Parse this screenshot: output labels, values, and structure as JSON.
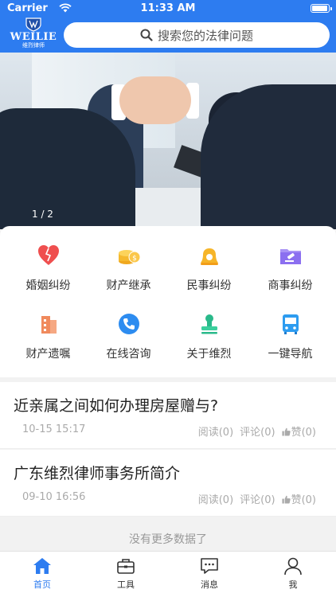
{
  "status_bar": {
    "carrier": "Carrier",
    "time": "11:33 AM"
  },
  "logo": {
    "word": "WEILIE",
    "subtitle": "维烈律师"
  },
  "search": {
    "placeholder": "搜索您的法律问题"
  },
  "banner": {
    "counter": "1 / 2"
  },
  "categories": [
    {
      "label": "婚姻纠纷",
      "icon": "broken-heart-icon",
      "color": "#ef4f4f"
    },
    {
      "label": "财产继承",
      "icon": "coins-icon",
      "color": "#f5b92e"
    },
    {
      "label": "民事纠纷",
      "icon": "bell-icon",
      "color": "#f6b529"
    },
    {
      "label": "商事纠纷",
      "icon": "gavel-folder-icon",
      "color": "#8b6ff0"
    },
    {
      "label": "财产遗嘱",
      "icon": "building-icon",
      "color": "#f08a5d"
    },
    {
      "label": "在线咨询",
      "icon": "phone-icon",
      "color": "#2d8cf0"
    },
    {
      "label": "关于维烈",
      "icon": "stamp-icon",
      "color": "#29b98a"
    },
    {
      "label": "一键导航",
      "icon": "bus-icon",
      "color": "#2d9cf0"
    }
  ],
  "articles": [
    {
      "title": "近亲属之间如何办理房屋赠与?",
      "date": "10-15 15:17",
      "reads": "阅读(0)",
      "comments": "评论(0)",
      "likes": "赞(0)"
    },
    {
      "title": "广东维烈律师事务所简介",
      "date": "09-10 16:56",
      "reads": "阅读(0)",
      "comments": "评论(0)",
      "likes": "赞(0)"
    }
  ],
  "list_footer": "没有更多数据了",
  "tabs": [
    {
      "label": "首页",
      "icon": "home-icon",
      "active": true
    },
    {
      "label": "工具",
      "icon": "toolbox-icon",
      "active": false
    },
    {
      "label": "消息",
      "icon": "message-icon",
      "active": false
    },
    {
      "label": "我",
      "icon": "user-icon",
      "active": false
    }
  ],
  "colors": {
    "brand": "#2d7cf0",
    "muted_text": "#aaaaaa"
  }
}
